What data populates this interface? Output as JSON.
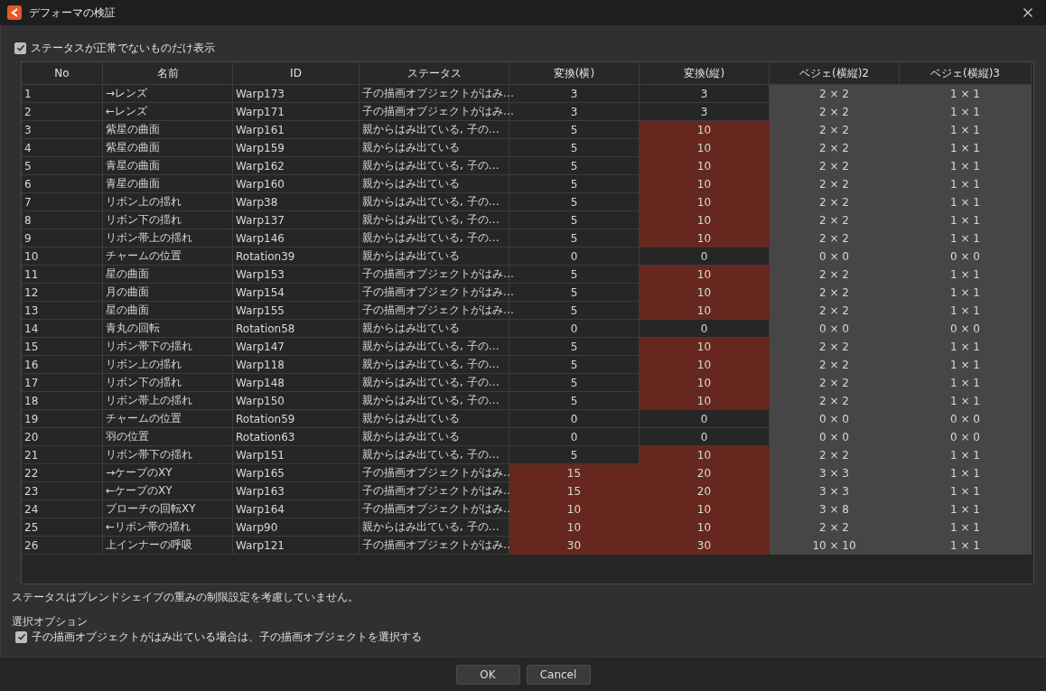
{
  "window": {
    "title": "デフォーマの検証"
  },
  "filter_checkbox": {
    "label": "ステータスが正常でないものだけ表示",
    "checked": true
  },
  "table": {
    "columns": [
      {
        "label": "No",
        "kind": "text"
      },
      {
        "label": "名前",
        "kind": "text"
      },
      {
        "label": "ID",
        "kind": "text"
      },
      {
        "label": "ステータス",
        "kind": "text"
      },
      {
        "label": "変換(横)",
        "kind": "number"
      },
      {
        "label": "変換(縦)",
        "kind": "number"
      },
      {
        "label": "ベジェ(横縦)2",
        "kind": "size"
      },
      {
        "label": "ベジェ(横縦)3",
        "kind": "size"
      }
    ],
    "rows": [
      {
        "no": "1",
        "name": "→レンズ",
        "id": "Warp173",
        "status": "子の描画オブジェクトがはみ…",
        "transform_h": "3",
        "transform_v": "3",
        "bezier_2": "2 × 2",
        "bezier_3": "1 × 1",
        "warn_h": false,
        "warn_v": false
      },
      {
        "no": "2",
        "name": "←レンズ",
        "id": "Warp171",
        "status": "子の描画オブジェクトがはみ…",
        "transform_h": "3",
        "transform_v": "3",
        "bezier_2": "2 × 2",
        "bezier_3": "1 × 1",
        "warn_h": false,
        "warn_v": false
      },
      {
        "no": "3",
        "name": "紫星の曲面",
        "id": "Warp161",
        "status": "親からはみ出ている, 子の…",
        "transform_h": "5",
        "transform_v": "10",
        "bezier_2": "2 × 2",
        "bezier_3": "1 × 1",
        "warn_h": false,
        "warn_v": true
      },
      {
        "no": "4",
        "name": "紫星の曲面",
        "id": "Warp159",
        "status": "親からはみ出ている",
        "transform_h": "5",
        "transform_v": "10",
        "bezier_2": "2 × 2",
        "bezier_3": "1 × 1",
        "warn_h": false,
        "warn_v": true
      },
      {
        "no": "5",
        "name": "青星の曲面",
        "id": "Warp162",
        "status": "親からはみ出ている, 子の…",
        "transform_h": "5",
        "transform_v": "10",
        "bezier_2": "2 × 2",
        "bezier_3": "1 × 1",
        "warn_h": false,
        "warn_v": true
      },
      {
        "no": "6",
        "name": "青星の曲面",
        "id": "Warp160",
        "status": "親からはみ出ている",
        "transform_h": "5",
        "transform_v": "10",
        "bezier_2": "2 × 2",
        "bezier_3": "1 × 1",
        "warn_h": false,
        "warn_v": true
      },
      {
        "no": "7",
        "name": "リボン上の揺れ",
        "id": "Warp38",
        "status": "親からはみ出ている, 子の…",
        "transform_h": "5",
        "transform_v": "10",
        "bezier_2": "2 × 2",
        "bezier_3": "1 × 1",
        "warn_h": false,
        "warn_v": true
      },
      {
        "no": "8",
        "name": "リボン下の揺れ",
        "id": "Warp137",
        "status": "親からはみ出ている, 子の…",
        "transform_h": "5",
        "transform_v": "10",
        "bezier_2": "2 × 2",
        "bezier_3": "1 × 1",
        "warn_h": false,
        "warn_v": true
      },
      {
        "no": "9",
        "name": "リボン帯上の揺れ",
        "id": "Warp146",
        "status": "親からはみ出ている, 子の…",
        "transform_h": "5",
        "transform_v": "10",
        "bezier_2": "2 × 2",
        "bezier_3": "1 × 1",
        "warn_h": false,
        "warn_v": true
      },
      {
        "no": "10",
        "name": "チャームの位置",
        "id": "Rotation39",
        "status": "親からはみ出ている",
        "transform_h": "0",
        "transform_v": "0",
        "bezier_2": "0 × 0",
        "bezier_3": "0 × 0",
        "warn_h": false,
        "warn_v": false
      },
      {
        "no": "11",
        "name": "星の曲面",
        "id": "Warp153",
        "status": "子の描画オブジェクトがはみ…",
        "transform_h": "5",
        "transform_v": "10",
        "bezier_2": "2 × 2",
        "bezier_3": "1 × 1",
        "warn_h": false,
        "warn_v": true
      },
      {
        "no": "12",
        "name": "月の曲面",
        "id": "Warp154",
        "status": "子の描画オブジェクトがはみ…",
        "transform_h": "5",
        "transform_v": "10",
        "bezier_2": "2 × 2",
        "bezier_3": "1 × 1",
        "warn_h": false,
        "warn_v": true
      },
      {
        "no": "13",
        "name": "星の曲面",
        "id": "Warp155",
        "status": "子の描画オブジェクトがはみ…",
        "transform_h": "5",
        "transform_v": "10",
        "bezier_2": "2 × 2",
        "bezier_3": "1 × 1",
        "warn_h": false,
        "warn_v": true
      },
      {
        "no": "14",
        "name": "青丸の回転",
        "id": "Rotation58",
        "status": "親からはみ出ている",
        "transform_h": "0",
        "transform_v": "0",
        "bezier_2": "0 × 0",
        "bezier_3": "0 × 0",
        "warn_h": false,
        "warn_v": false
      },
      {
        "no": "15",
        "name": "リボン帯下の揺れ",
        "id": "Warp147",
        "status": "親からはみ出ている, 子の…",
        "transform_h": "5",
        "transform_v": "10",
        "bezier_2": "2 × 2",
        "bezier_3": "1 × 1",
        "warn_h": false,
        "warn_v": true
      },
      {
        "no": "16",
        "name": "リボン上の揺れ",
        "id": "Warp118",
        "status": "親からはみ出ている, 子の…",
        "transform_h": "5",
        "transform_v": "10",
        "bezier_2": "2 × 2",
        "bezier_3": "1 × 1",
        "warn_h": false,
        "warn_v": true
      },
      {
        "no": "17",
        "name": "リボン下の揺れ",
        "id": "Warp148",
        "status": "親からはみ出ている, 子の…",
        "transform_h": "5",
        "transform_v": "10",
        "bezier_2": "2 × 2",
        "bezier_3": "1 × 1",
        "warn_h": false,
        "warn_v": true
      },
      {
        "no": "18",
        "name": "リボン帯上の揺れ",
        "id": "Warp150",
        "status": "親からはみ出ている, 子の…",
        "transform_h": "5",
        "transform_v": "10",
        "bezier_2": "2 × 2",
        "bezier_3": "1 × 1",
        "warn_h": false,
        "warn_v": true
      },
      {
        "no": "19",
        "name": "チャームの位置",
        "id": "Rotation59",
        "status": "親からはみ出ている",
        "transform_h": "0",
        "transform_v": "0",
        "bezier_2": "0 × 0",
        "bezier_3": "0 × 0",
        "warn_h": false,
        "warn_v": false
      },
      {
        "no": "20",
        "name": "羽の位置",
        "id": "Rotation63",
        "status": "親からはみ出ている",
        "transform_h": "0",
        "transform_v": "0",
        "bezier_2": "0 × 0",
        "bezier_3": "0 × 0",
        "warn_h": false,
        "warn_v": false
      },
      {
        "no": "21",
        "name": "リボン帯下の揺れ",
        "id": "Warp151",
        "status": "親からはみ出ている, 子の…",
        "transform_h": "5",
        "transform_v": "10",
        "bezier_2": "2 × 2",
        "bezier_3": "1 × 1",
        "warn_h": false,
        "warn_v": true
      },
      {
        "no": "22",
        "name": "→ケープのXY",
        "id": "Warp165",
        "status": "子の描画オブジェクトがはみ…",
        "transform_h": "15",
        "transform_v": "20",
        "bezier_2": "3 × 3",
        "bezier_3": "1 × 1",
        "warn_h": true,
        "warn_v": true
      },
      {
        "no": "23",
        "name": "←ケープのXY",
        "id": "Warp163",
        "status": "子の描画オブジェクトがはみ…",
        "transform_h": "15",
        "transform_v": "20",
        "bezier_2": "3 × 3",
        "bezier_3": "1 × 1",
        "warn_h": true,
        "warn_v": true
      },
      {
        "no": "24",
        "name": "ブローチの回転XY",
        "id": "Warp164",
        "status": "子の描画オブジェクトがはみ…",
        "transform_h": "10",
        "transform_v": "10",
        "bezier_2": "3 × 8",
        "bezier_3": "1 × 1",
        "warn_h": true,
        "warn_v": true
      },
      {
        "no": "25",
        "name": "←リボン帯の揺れ",
        "id": "Warp90",
        "status": "親からはみ出ている, 子の…",
        "transform_h": "10",
        "transform_v": "10",
        "bezier_2": "2 × 2",
        "bezier_3": "1 × 1",
        "warn_h": true,
        "warn_v": true
      },
      {
        "no": "26",
        "name": "上インナーの呼吸",
        "id": "Warp121",
        "status": "子の描画オブジェクトがはみ…",
        "transform_h": "30",
        "transform_v": "30",
        "bezier_2": "10 × 10",
        "bezier_3": "1 × 1",
        "warn_h": true,
        "warn_v": true
      }
    ]
  },
  "note": "ステータスはブレンドシェイプの重みの制限設定を考慮していません。",
  "selection_options": {
    "title": "選択オプション",
    "checkbox": {
      "label": "子の描画オブジェクトがはみ出ている場合は、子の描画オブジェクトを選択する",
      "checked": true
    }
  },
  "buttons": [
    "OK",
    "Cancel"
  ]
}
